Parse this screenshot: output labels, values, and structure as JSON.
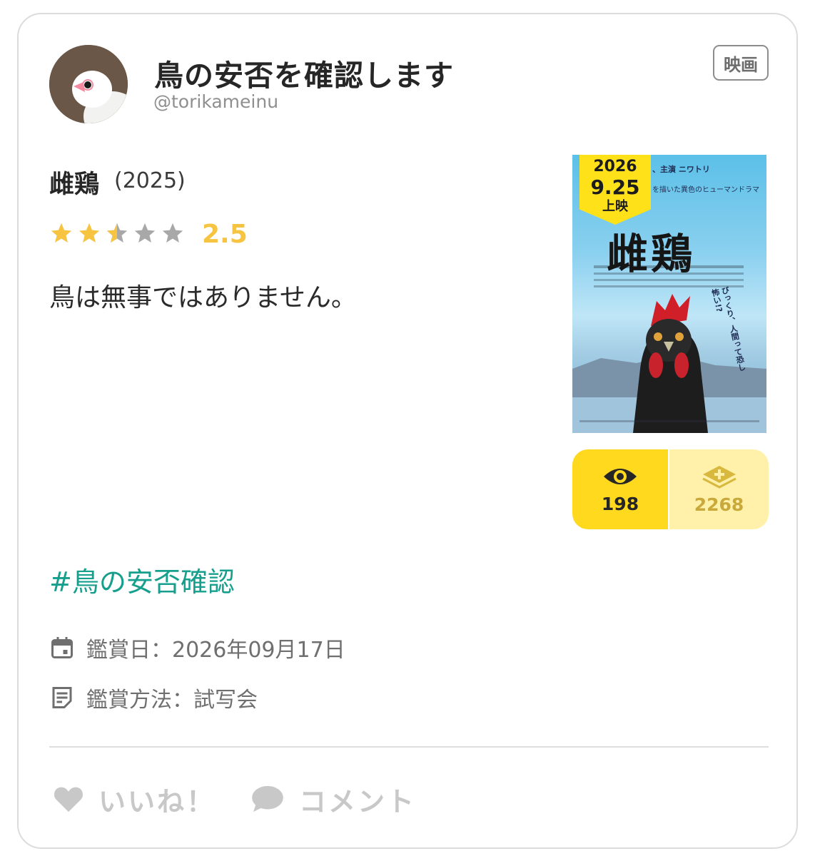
{
  "user": {
    "name": "鳥の安否を確認します",
    "handle": "@torikameinu"
  },
  "category": "映画",
  "movie": {
    "title": "雌鶏",
    "year": "(2025)",
    "rating": "2.5",
    "rating_value": 2.5,
    "rating_max": 5,
    "review": "鳥は無事ではありません。",
    "poster": {
      "badge_year": "2026",
      "badge_date": "9.25",
      "badge_label": "上映",
      "title": "雌鶏",
      "copy_line1": "、主演 ニワトリ",
      "copy_line2": "を描いた異色のヒューマンドラマ",
      "vertical_copy": "びっくり、人間って恐し怖い!?"
    }
  },
  "stats": {
    "watched": "198",
    "clipped": "2268"
  },
  "hashtag": "#鳥の安否確認",
  "meta": {
    "date": "鑑賞日：2026年09月17日",
    "method": "鑑賞方法：試写会"
  },
  "actions": {
    "like": "いいね！",
    "comment": "コメント"
  },
  "colors": {
    "star_active": "#f7c441",
    "star_inactive": "#a8a8a8",
    "hashtag": "#169f8c",
    "watch_bg": "#ffd91e",
    "clip_bg": "#fff1aa"
  }
}
